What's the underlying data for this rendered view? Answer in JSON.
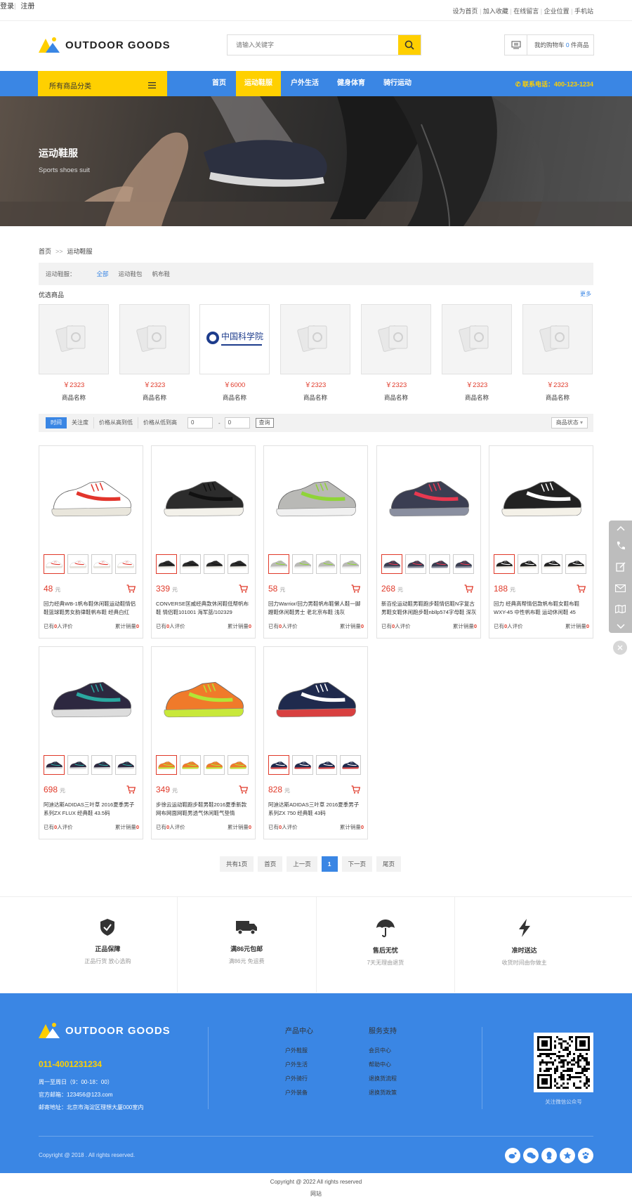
{
  "topbar": {
    "login": "登录",
    "register": "注册",
    "links": [
      "设为首页",
      "加入收藏",
      "在线留言",
      "企业位置",
      "手机站"
    ]
  },
  "header": {
    "logo_text": "OUTDOOR GOODS",
    "search_placeholder": "请输入关键字",
    "cart_prefix": "我的购物车",
    "cart_count": "0",
    "cart_suffix": "件商品"
  },
  "nav": {
    "all_categories": "所有商品分类",
    "items": [
      "首页",
      "运动鞋服",
      "户外生活",
      "健身体育",
      "骑行运动"
    ],
    "active": "运动鞋服",
    "phone": "联系电话：400-123-1234"
  },
  "banner": {
    "title": "运动鞋服",
    "subtitle": "Sports shoes suit"
  },
  "breadcrumb": {
    "home": "首页",
    "sep": ">>",
    "current": "运动鞋服"
  },
  "filter": {
    "label": "运动鞋服：",
    "options": [
      "全部",
      "运动鞋包",
      "帆布鞋"
    ],
    "active": "全部"
  },
  "selected": {
    "title": "优选商品",
    "more": "更多",
    "items": [
      {
        "price": "￥2323",
        "name": "商品名称"
      },
      {
        "price": "￥2323",
        "name": "商品名称"
      },
      {
        "price": "￥6000",
        "name": "商品名称"
      },
      {
        "price": "￥2323",
        "name": "商品名称"
      },
      {
        "price": "￥2323",
        "name": "商品名称"
      },
      {
        "price": "￥2323",
        "name": "商品名称"
      },
      {
        "price": "￥2323",
        "name": "商品名称"
      }
    ]
  },
  "sortbar": {
    "options": [
      "时间",
      "关注度",
      "价格从高到低",
      "价格从低到高"
    ],
    "active": "时间",
    "min": "0",
    "max": "0",
    "dash": "-",
    "query": "查询",
    "status": "商品状态"
  },
  "products": [
    {
      "price": "48",
      "unit": "元",
      "name": "回力经典WB-1帆布鞋休闲鞋运动鞋情侣鞋篮球鞋男女韵律鞋帆布鞋 经典白红",
      "reviews": "0",
      "sales": "0"
    },
    {
      "price": "339",
      "unit": "元",
      "name": "CONVERSE匡威经典款休闲鞋低帮帆布鞋 情侣鞋101001 海军蓝/102329",
      "reviews": "0",
      "sales": "0"
    },
    {
      "price": "58",
      "unit": "元",
      "name": "回力Warrior/回力男鞋帆布鞋懒人鞋一脚蹬鞋休闲鞋男士 老北京布鞋 浅灰",
      "reviews": "0",
      "sales": "0"
    },
    {
      "price": "268",
      "unit": "元",
      "name": "新百伦运动鞋男鞋跑步鞋情侣鞋N字复古男鞋女鞋休闲跑步鞋nbllp574字母鞋 深灰",
      "reviews": "0",
      "sales": "0"
    },
    {
      "price": "188",
      "unit": "元",
      "name": "回力 经典高帮情侣款帆布鞋女鞋布鞋 WXY-45 中性帆布鞋 运动休闲鞋 45",
      "reviews": "0",
      "sales": "0"
    },
    {
      "price": "698",
      "unit": "元",
      "name": "阿迪达斯ADIDAS三叶草 2016夏季男子系列ZX FLUX 经典鞋 43.5码",
      "reviews": "0",
      "sales": "0"
    },
    {
      "price": "349",
      "unit": "元",
      "name": "步徐云运动鞋跑步鞋男鞋2016夏季新款网布网面网鞋男透气休闲鞋气垫情",
      "reviews": "0",
      "sales": "0"
    },
    {
      "price": "828",
      "unit": "元",
      "name": "阿迪达斯ADIDAS三叶草 2016夏季男子系列ZX 750 经典鞋 43码",
      "reviews": "0",
      "sales": "0"
    }
  ],
  "product_labels": {
    "reviews_prefix": "已有",
    "reviews_suffix": "人评价",
    "sales_prefix": "累计销量"
  },
  "pager": {
    "total": "共有1页",
    "first": "首页",
    "prev": "上一页",
    "current": "1",
    "next": "下一页",
    "last": "尾页"
  },
  "features": [
    {
      "title": "正品保障",
      "desc": "正品行货 放心选购"
    },
    {
      "title": "满86元包邮",
      "desc": "满86元 免运费"
    },
    {
      "title": "售后无忧",
      "desc": "7天无理由退货"
    },
    {
      "title": "准时送达",
      "desc": "收货时间由你做主"
    }
  ],
  "footer": {
    "logo_text": "OUTDOOR GOODS",
    "tel": "011-4001231234",
    "hours": "周一至周日（9：00-18：00）",
    "email": "官方邮箱：123456@123.com",
    "address": "邮寄地址：北京市海淀区理想大厦000室内",
    "col1_title": "产品中心",
    "col1_items": [
      "户外鞋服",
      "户外生活",
      "户外骑行",
      "户外装备"
    ],
    "col2_title": "服务支持",
    "col2_items": [
      "会员中心",
      "帮助中心",
      "退换货流程",
      "退换货政策"
    ],
    "qr_caption": "关注微信公众号",
    "copyright": "Copyright @ 2018 . All rights reserved.",
    "copyright2": "Copyright @ 2022    All rights reserved",
    "site": "网站"
  },
  "colors": {
    "brand_blue": "#3a86e4",
    "accent_yellow": "#ffd000",
    "price_red": "#e03a2a"
  },
  "shoes": [
    {
      "base": "#ffffff",
      "accent": "#e2352c",
      "sole": "#e9e6dc"
    },
    {
      "base": "#2c2c2c",
      "accent": "#111111",
      "sole": "#f3f1ea"
    },
    {
      "base": "#b9b9b6",
      "accent": "#8fd438",
      "sole": "#f0f0f0"
    },
    {
      "base": "#3b3e52",
      "accent": "#e83850",
      "sole": "#8a8fa0"
    },
    {
      "base": "#222222",
      "accent": "#ffffff",
      "sole": "#f4f1e8"
    },
    {
      "base": "#2d2840",
      "accent": "#2aa8a0",
      "sole": "#dcdcdc"
    },
    {
      "base": "#f07a2a",
      "accent": "#b3e536",
      "sole": "#c8e83a"
    },
    {
      "base": "#1f2a4d",
      "accent": "#ffffff",
      "sole": "#d84040"
    }
  ]
}
